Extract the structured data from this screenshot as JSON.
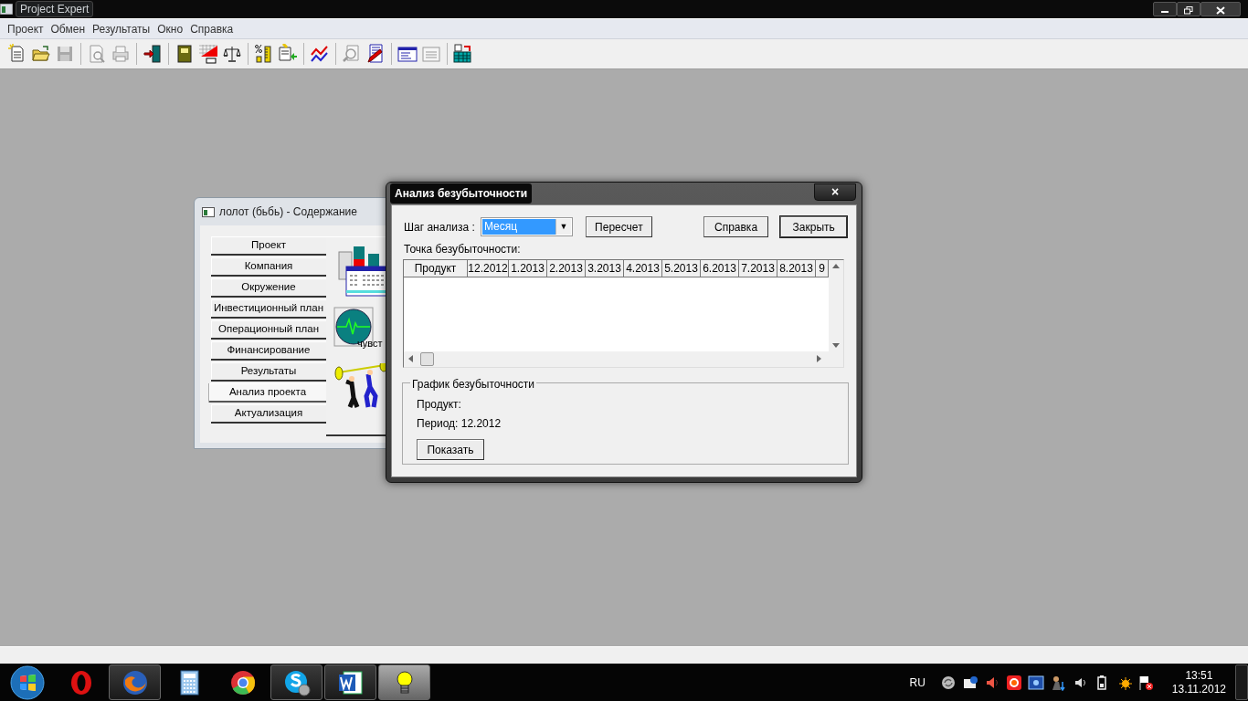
{
  "app_window": {
    "title": "Project Expert"
  },
  "menu": [
    "Проект",
    "Обмен",
    "Результаты",
    "Окно",
    "Справка"
  ],
  "toolbar": [
    [
      {
        "disabled": false
      },
      {
        "disabled": false
      },
      {
        "disabled": true
      }
    ],
    [
      {
        "disabled": true
      },
      {
        "disabled": true
      }
    ],
    [
      {
        "disabled": false
      }
    ],
    [
      {
        "disabled": false
      },
      {
        "disabled": false
      },
      {
        "disabled": false
      }
    ],
    [
      {
        "disabled": false
      },
      {
        "disabled": false
      }
    ],
    [
      {
        "disabled": false
      }
    ],
    [
      {
        "disabled": true
      },
      {
        "disabled": false
      }
    ],
    [
      {
        "disabled": false
      },
      {
        "disabled": true
      }
    ],
    [
      {
        "disabled": false
      }
    ]
  ],
  "content_window": {
    "title": "лолот (бьбь) - Содержание",
    "items": [
      {
        "label": "Проект",
        "selected": false
      },
      {
        "label": "Компания",
        "selected": false
      },
      {
        "label": "Окружение",
        "selected": false
      },
      {
        "label": "Инвестиционный план",
        "selected": false
      },
      {
        "label": "Операционный план",
        "selected": false
      },
      {
        "label": "Финансирование",
        "selected": false
      },
      {
        "label": "Результаты",
        "selected": false
      },
      {
        "label": "Анализ проекта",
        "selected": true
      },
      {
        "label": "Актуализация",
        "selected": false
      }
    ],
    "panel_caption": "чувст"
  },
  "dialog": {
    "title": "Анализ безубыточности",
    "close": "×",
    "step_label": "Шаг анализа :",
    "step_value": "Месяц",
    "dropdown_arrow": "▼",
    "buttons": [
      {
        "label": "Пересчет",
        "default": false
      },
      {
        "label": "Справка",
        "default": false
      },
      {
        "label": "Закрыть",
        "default": true
      }
    ],
    "table_label": "Точка безубыточности:",
    "table": {
      "columns": [
        "Продукт",
        "12.2012",
        "1.2013",
        "2.2013",
        "3.2013",
        "4.2013",
        "5.2013",
        "6.2013",
        "7.2013",
        "8.2013",
        "9"
      ]
    },
    "group": {
      "title": "График безубыточности",
      "product_label": "Продукт:",
      "period_label": "Период: 12.2012",
      "button": "Показать"
    }
  },
  "taskbar": {
    "apps": [
      {
        "running": false,
        "selected": false
      },
      {
        "running": true,
        "selected": false
      },
      {
        "running": false,
        "selected": false
      },
      {
        "running": false,
        "selected": false
      },
      {
        "running": true,
        "selected": false
      },
      {
        "running": true,
        "selected": false
      },
      {
        "running": true,
        "selected": true
      }
    ],
    "language": "RU",
    "time": "13:51",
    "date": "13.11.2012"
  }
}
